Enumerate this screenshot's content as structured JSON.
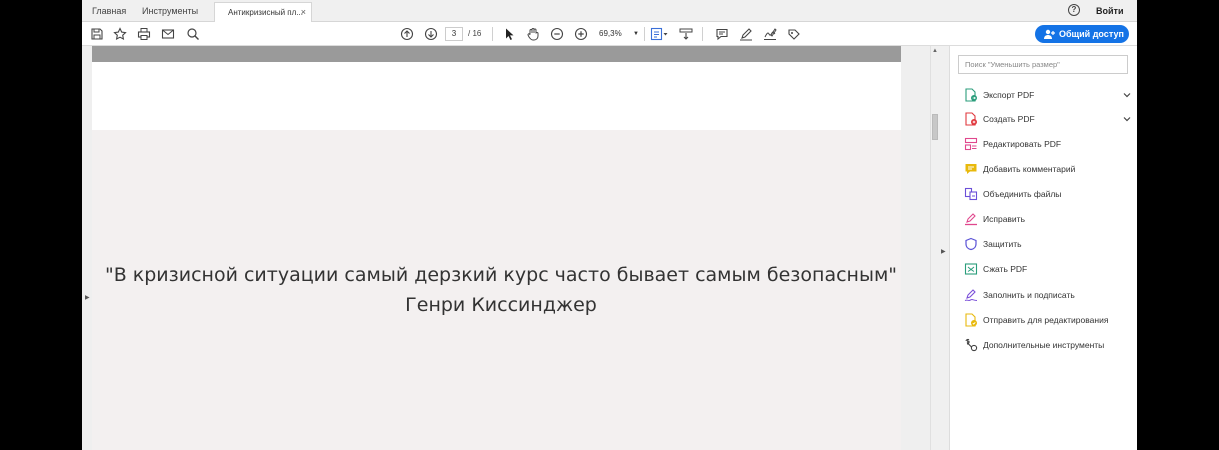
{
  "tabbar": {
    "home_label": "Главная",
    "tools_label": "Инструменты",
    "doc_tab_label": "Антикризисный пл...",
    "close_glyph": "×",
    "help_glyph": "?",
    "login_label": "Войти"
  },
  "toolbar": {
    "page_current": "3",
    "page_total": "/ 16",
    "zoom": "69,3%",
    "share_label": "Общий доступ"
  },
  "document": {
    "quote": "\"В кризисной ситуации самый дерзкий курс часто бывает самым безопасным\"",
    "author": "Генри Киссинджер"
  },
  "panel": {
    "search_placeholder": "Поиск \"Уменьшить размер\"",
    "tools": [
      {
        "label": "Экспорт PDF",
        "icon": "export-pdf-icon",
        "color": "#2a9d7b"
      },
      {
        "label": "Создать PDF",
        "icon": "create-pdf-icon",
        "color": "#e0383e"
      },
      {
        "label": "Редактировать PDF",
        "icon": "edit-pdf-icon",
        "color": "#e0478d"
      },
      {
        "label": "Добавить комментарий",
        "icon": "comment-icon",
        "color": "#e8b90c"
      },
      {
        "label": "Объединить файлы",
        "icon": "combine-files-icon",
        "color": "#6b4fd8"
      },
      {
        "label": "Исправить",
        "icon": "redact-icon",
        "color": "#e0478d"
      },
      {
        "label": "Защитить",
        "icon": "protect-icon",
        "color": "#5a52d6"
      },
      {
        "label": "Сжать PDF",
        "icon": "compress-pdf-icon",
        "color": "#2a9d7b"
      },
      {
        "label": "Заполнить и подписать",
        "icon": "fill-sign-icon",
        "color": "#7a4fd8"
      },
      {
        "label": "Отправить для редактирования",
        "icon": "send-review-icon",
        "color": "#e8b90c"
      },
      {
        "label": "Дополнительные инструменты",
        "icon": "more-tools-icon",
        "color": "#444444"
      }
    ]
  }
}
